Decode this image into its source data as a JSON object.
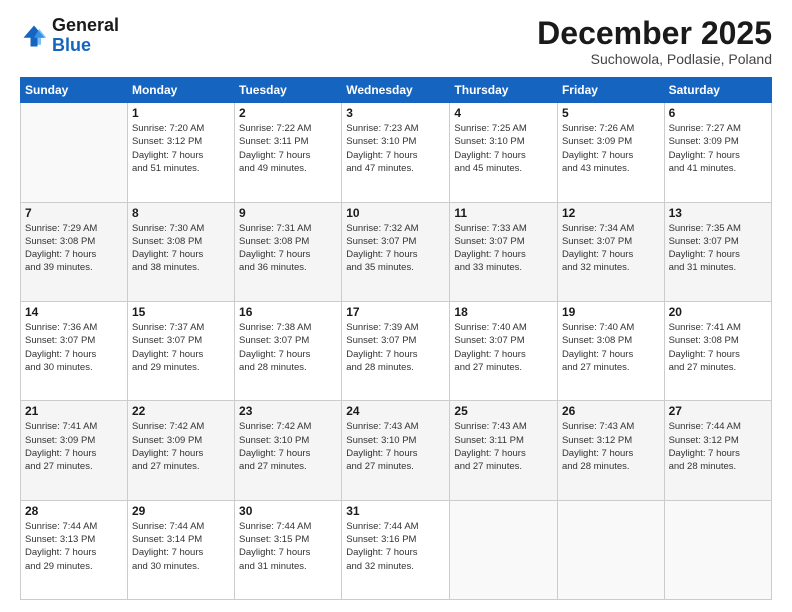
{
  "logo": {
    "line1": "General",
    "line2": "Blue"
  },
  "title": "December 2025",
  "location": "Suchowola, Podlasie, Poland",
  "days_of_week": [
    "Sunday",
    "Monday",
    "Tuesday",
    "Wednesday",
    "Thursday",
    "Friday",
    "Saturday"
  ],
  "weeks": [
    [
      {
        "day": "",
        "sunrise": "",
        "sunset": "",
        "daylight": "",
        "daylight2": ""
      },
      {
        "day": "1",
        "sunrise": "Sunrise: 7:20 AM",
        "sunset": "Sunset: 3:12 PM",
        "daylight": "Daylight: 7 hours",
        "daylight2": "and 51 minutes."
      },
      {
        "day": "2",
        "sunrise": "Sunrise: 7:22 AM",
        "sunset": "Sunset: 3:11 PM",
        "daylight": "Daylight: 7 hours",
        "daylight2": "and 49 minutes."
      },
      {
        "day": "3",
        "sunrise": "Sunrise: 7:23 AM",
        "sunset": "Sunset: 3:10 PM",
        "daylight": "Daylight: 7 hours",
        "daylight2": "and 47 minutes."
      },
      {
        "day": "4",
        "sunrise": "Sunrise: 7:25 AM",
        "sunset": "Sunset: 3:10 PM",
        "daylight": "Daylight: 7 hours",
        "daylight2": "and 45 minutes."
      },
      {
        "day": "5",
        "sunrise": "Sunrise: 7:26 AM",
        "sunset": "Sunset: 3:09 PM",
        "daylight": "Daylight: 7 hours",
        "daylight2": "and 43 minutes."
      },
      {
        "day": "6",
        "sunrise": "Sunrise: 7:27 AM",
        "sunset": "Sunset: 3:09 PM",
        "daylight": "Daylight: 7 hours",
        "daylight2": "and 41 minutes."
      }
    ],
    [
      {
        "day": "7",
        "sunrise": "Sunrise: 7:29 AM",
        "sunset": "Sunset: 3:08 PM",
        "daylight": "Daylight: 7 hours",
        "daylight2": "and 39 minutes."
      },
      {
        "day": "8",
        "sunrise": "Sunrise: 7:30 AM",
        "sunset": "Sunset: 3:08 PM",
        "daylight": "Daylight: 7 hours",
        "daylight2": "and 38 minutes."
      },
      {
        "day": "9",
        "sunrise": "Sunrise: 7:31 AM",
        "sunset": "Sunset: 3:08 PM",
        "daylight": "Daylight: 7 hours",
        "daylight2": "and 36 minutes."
      },
      {
        "day": "10",
        "sunrise": "Sunrise: 7:32 AM",
        "sunset": "Sunset: 3:07 PM",
        "daylight": "Daylight: 7 hours",
        "daylight2": "and 35 minutes."
      },
      {
        "day": "11",
        "sunrise": "Sunrise: 7:33 AM",
        "sunset": "Sunset: 3:07 PM",
        "daylight": "Daylight: 7 hours",
        "daylight2": "and 33 minutes."
      },
      {
        "day": "12",
        "sunrise": "Sunrise: 7:34 AM",
        "sunset": "Sunset: 3:07 PM",
        "daylight": "Daylight: 7 hours",
        "daylight2": "and 32 minutes."
      },
      {
        "day": "13",
        "sunrise": "Sunrise: 7:35 AM",
        "sunset": "Sunset: 3:07 PM",
        "daylight": "Daylight: 7 hours",
        "daylight2": "and 31 minutes."
      }
    ],
    [
      {
        "day": "14",
        "sunrise": "Sunrise: 7:36 AM",
        "sunset": "Sunset: 3:07 PM",
        "daylight": "Daylight: 7 hours",
        "daylight2": "and 30 minutes."
      },
      {
        "day": "15",
        "sunrise": "Sunrise: 7:37 AM",
        "sunset": "Sunset: 3:07 PM",
        "daylight": "Daylight: 7 hours",
        "daylight2": "and 29 minutes."
      },
      {
        "day": "16",
        "sunrise": "Sunrise: 7:38 AM",
        "sunset": "Sunset: 3:07 PM",
        "daylight": "Daylight: 7 hours",
        "daylight2": "and 28 minutes."
      },
      {
        "day": "17",
        "sunrise": "Sunrise: 7:39 AM",
        "sunset": "Sunset: 3:07 PM",
        "daylight": "Daylight: 7 hours",
        "daylight2": "and 28 minutes."
      },
      {
        "day": "18",
        "sunrise": "Sunrise: 7:40 AM",
        "sunset": "Sunset: 3:07 PM",
        "daylight": "Daylight: 7 hours",
        "daylight2": "and 27 minutes."
      },
      {
        "day": "19",
        "sunrise": "Sunrise: 7:40 AM",
        "sunset": "Sunset: 3:08 PM",
        "daylight": "Daylight: 7 hours",
        "daylight2": "and 27 minutes."
      },
      {
        "day": "20",
        "sunrise": "Sunrise: 7:41 AM",
        "sunset": "Sunset: 3:08 PM",
        "daylight": "Daylight: 7 hours",
        "daylight2": "and 27 minutes."
      }
    ],
    [
      {
        "day": "21",
        "sunrise": "Sunrise: 7:41 AM",
        "sunset": "Sunset: 3:09 PM",
        "daylight": "Daylight: 7 hours",
        "daylight2": "and 27 minutes."
      },
      {
        "day": "22",
        "sunrise": "Sunrise: 7:42 AM",
        "sunset": "Sunset: 3:09 PM",
        "daylight": "Daylight: 7 hours",
        "daylight2": "and 27 minutes."
      },
      {
        "day": "23",
        "sunrise": "Sunrise: 7:42 AM",
        "sunset": "Sunset: 3:10 PM",
        "daylight": "Daylight: 7 hours",
        "daylight2": "and 27 minutes."
      },
      {
        "day": "24",
        "sunrise": "Sunrise: 7:43 AM",
        "sunset": "Sunset: 3:10 PM",
        "daylight": "Daylight: 7 hours",
        "daylight2": "and 27 minutes."
      },
      {
        "day": "25",
        "sunrise": "Sunrise: 7:43 AM",
        "sunset": "Sunset: 3:11 PM",
        "daylight": "Daylight: 7 hours",
        "daylight2": "and 27 minutes."
      },
      {
        "day": "26",
        "sunrise": "Sunrise: 7:43 AM",
        "sunset": "Sunset: 3:12 PM",
        "daylight": "Daylight: 7 hours",
        "daylight2": "and 28 minutes."
      },
      {
        "day": "27",
        "sunrise": "Sunrise: 7:44 AM",
        "sunset": "Sunset: 3:12 PM",
        "daylight": "Daylight: 7 hours",
        "daylight2": "and 28 minutes."
      }
    ],
    [
      {
        "day": "28",
        "sunrise": "Sunrise: 7:44 AM",
        "sunset": "Sunset: 3:13 PM",
        "daylight": "Daylight: 7 hours",
        "daylight2": "and 29 minutes."
      },
      {
        "day": "29",
        "sunrise": "Sunrise: 7:44 AM",
        "sunset": "Sunset: 3:14 PM",
        "daylight": "Daylight: 7 hours",
        "daylight2": "and 30 minutes."
      },
      {
        "day": "30",
        "sunrise": "Sunrise: 7:44 AM",
        "sunset": "Sunset: 3:15 PM",
        "daylight": "Daylight: 7 hours",
        "daylight2": "and 31 minutes."
      },
      {
        "day": "31",
        "sunrise": "Sunrise: 7:44 AM",
        "sunset": "Sunset: 3:16 PM",
        "daylight": "Daylight: 7 hours",
        "daylight2": "and 32 minutes."
      },
      {
        "day": "",
        "sunrise": "",
        "sunset": "",
        "daylight": "",
        "daylight2": ""
      },
      {
        "day": "",
        "sunrise": "",
        "sunset": "",
        "daylight": "",
        "daylight2": ""
      },
      {
        "day": "",
        "sunrise": "",
        "sunset": "",
        "daylight": "",
        "daylight2": ""
      }
    ]
  ]
}
